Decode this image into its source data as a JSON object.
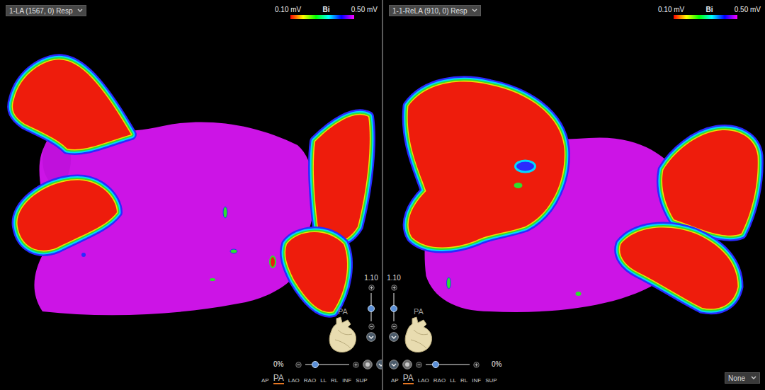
{
  "panels": [
    {
      "title": "1-LA (1567, 0) Resp",
      "scale": {
        "min": "0.10 mV",
        "mode": "Bi",
        "max": "0.50 mV"
      },
      "zoom": "1.10",
      "zoom_level": 0.44,
      "orientation": "PA",
      "transparency": "0%",
      "transparency_level": 0.22,
      "views": [
        {
          "label": "AP",
          "selected": false
        },
        {
          "label": "PA",
          "selected": true
        },
        {
          "label": "LAO",
          "selected": false
        },
        {
          "label": "RAO",
          "selected": false
        },
        {
          "label": "LL",
          "selected": false
        },
        {
          "label": "RL",
          "selected": false
        },
        {
          "label": "INF",
          "selected": false
        },
        {
          "label": "SUP",
          "selected": false
        }
      ]
    },
    {
      "title": "1-1-ReLA (910, 0) Resp",
      "scale": {
        "min": "0.10 mV",
        "mode": "Bi",
        "max": "0.50 mV"
      },
      "zoom": "1.10",
      "zoom_level": 0.44,
      "orientation": "PA",
      "transparency": "0%",
      "transparency_level": 0.22,
      "views": [
        {
          "label": "AP",
          "selected": false
        },
        {
          "label": "PA",
          "selected": true
        },
        {
          "label": "LAO",
          "selected": false
        },
        {
          "label": "RAO",
          "selected": false
        },
        {
          "label": "LL",
          "selected": false
        },
        {
          "label": "RL",
          "selected": false
        },
        {
          "label": "INF",
          "selected": false
        },
        {
          "label": "SUP",
          "selected": false
        }
      ]
    }
  ],
  "overlay_dropdown": {
    "value": "None"
  }
}
